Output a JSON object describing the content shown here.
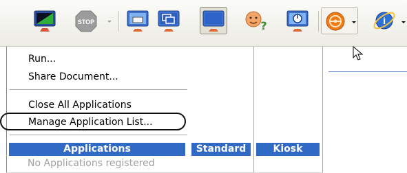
{
  "toolbar": {
    "buttons": [
      {
        "name": "monitor-screen-icon"
      },
      {
        "name": "stop-icon",
        "label": "STOP"
      },
      {
        "name": "monitor-lock-icon"
      },
      {
        "name": "windows-icon"
      },
      {
        "name": "monitor-icon"
      },
      {
        "name": "help-user-icon"
      },
      {
        "name": "monitor-power-icon"
      },
      {
        "name": "steering-wheel-icon"
      },
      {
        "name": "browser-globe-icon"
      }
    ]
  },
  "menu": {
    "items": [
      {
        "label": "Run..."
      },
      {
        "label": "Share Document..."
      },
      {
        "label": "Close All Applications"
      },
      {
        "label": "Manage Application List..."
      }
    ]
  },
  "applications": {
    "headers": {
      "applications": "Applications",
      "standard": "Standard",
      "kiosk": "Kiosk"
    },
    "empty_text": "No Applications registered"
  },
  "colors": {
    "header_bg": "#316ac5",
    "accent_orange": "#f07a14"
  }
}
